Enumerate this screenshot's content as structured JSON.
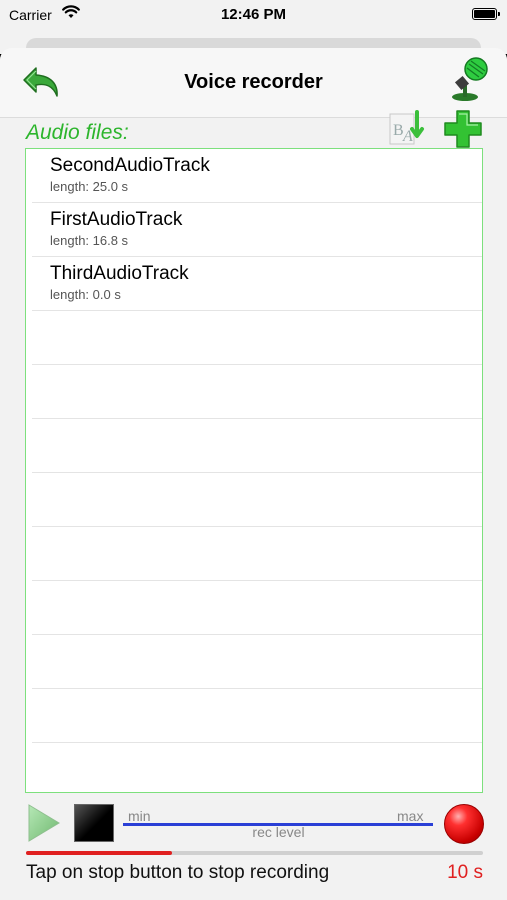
{
  "status_bar": {
    "carrier": "Carrier",
    "time": "12:46 PM"
  },
  "nav": {
    "title": "Voice recorder"
  },
  "list": {
    "header": "Audio files:",
    "items": [
      {
        "name": "SecondAudioTrack",
        "length": "length: 25.0 s"
      },
      {
        "name": "FirstAudioTrack",
        "length": "length: 16.8 s"
      },
      {
        "name": "ThirdAudioTrack",
        "length": "length: 0.0 s"
      }
    ],
    "empty_rows": 8
  },
  "recorder": {
    "level_min": "min",
    "level_max": "max",
    "level_label": "rec level",
    "level_value": 0.0,
    "progress": 0.32,
    "hint": "Tap on stop button to stop recording",
    "timer": "10 s"
  },
  "colors": {
    "accent_green": "#2db52d",
    "record_red": "#e02020",
    "level_blue": "#2a3fd6"
  },
  "icons": {
    "back": "undo-arrow-icon",
    "mic": "microphone-icon",
    "sort": "sort-alpha-icon",
    "add": "plus-icon",
    "play": "play-icon",
    "stop": "stop-icon",
    "record": "record-icon"
  }
}
